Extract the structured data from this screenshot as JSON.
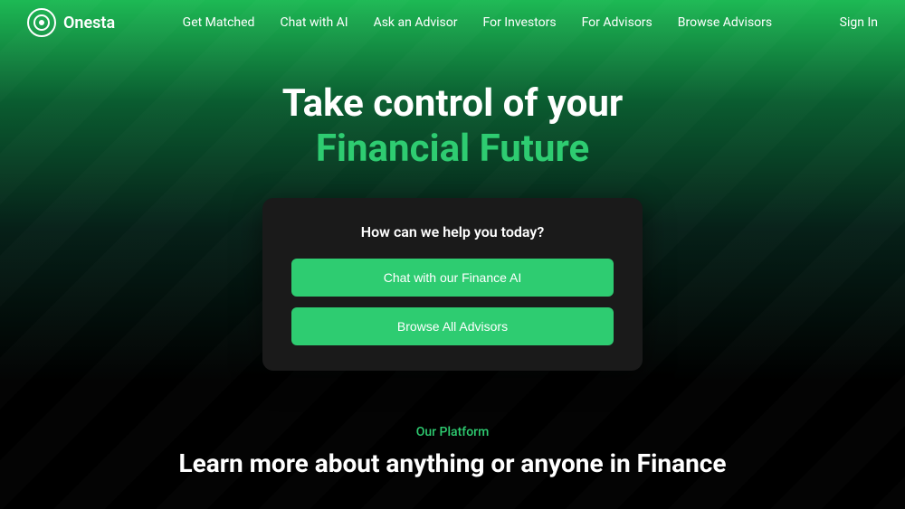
{
  "logo": {
    "icon": "O",
    "name": "Onesta"
  },
  "nav": {
    "links": [
      {
        "label": "Get Matched",
        "id": "get-matched"
      },
      {
        "label": "Chat with AI",
        "id": "chat-ai"
      },
      {
        "label": "Ask an Advisor",
        "id": "ask-advisor"
      },
      {
        "label": "For Investors",
        "id": "for-investors"
      },
      {
        "label": "For Advisors",
        "id": "for-advisors"
      },
      {
        "label": "Browse Advisors",
        "id": "browse-advisors"
      }
    ],
    "signin": "Sign In"
  },
  "hero": {
    "title_line1": "Take control of your",
    "title_line2": "Financial Future"
  },
  "card": {
    "question": "How can we help you today?",
    "btn1": "Chat with our Finance AI",
    "btn2": "Browse All Advisors"
  },
  "platform": {
    "label": "Our Platform",
    "title": "Learn more about anything or anyone in Finance"
  }
}
